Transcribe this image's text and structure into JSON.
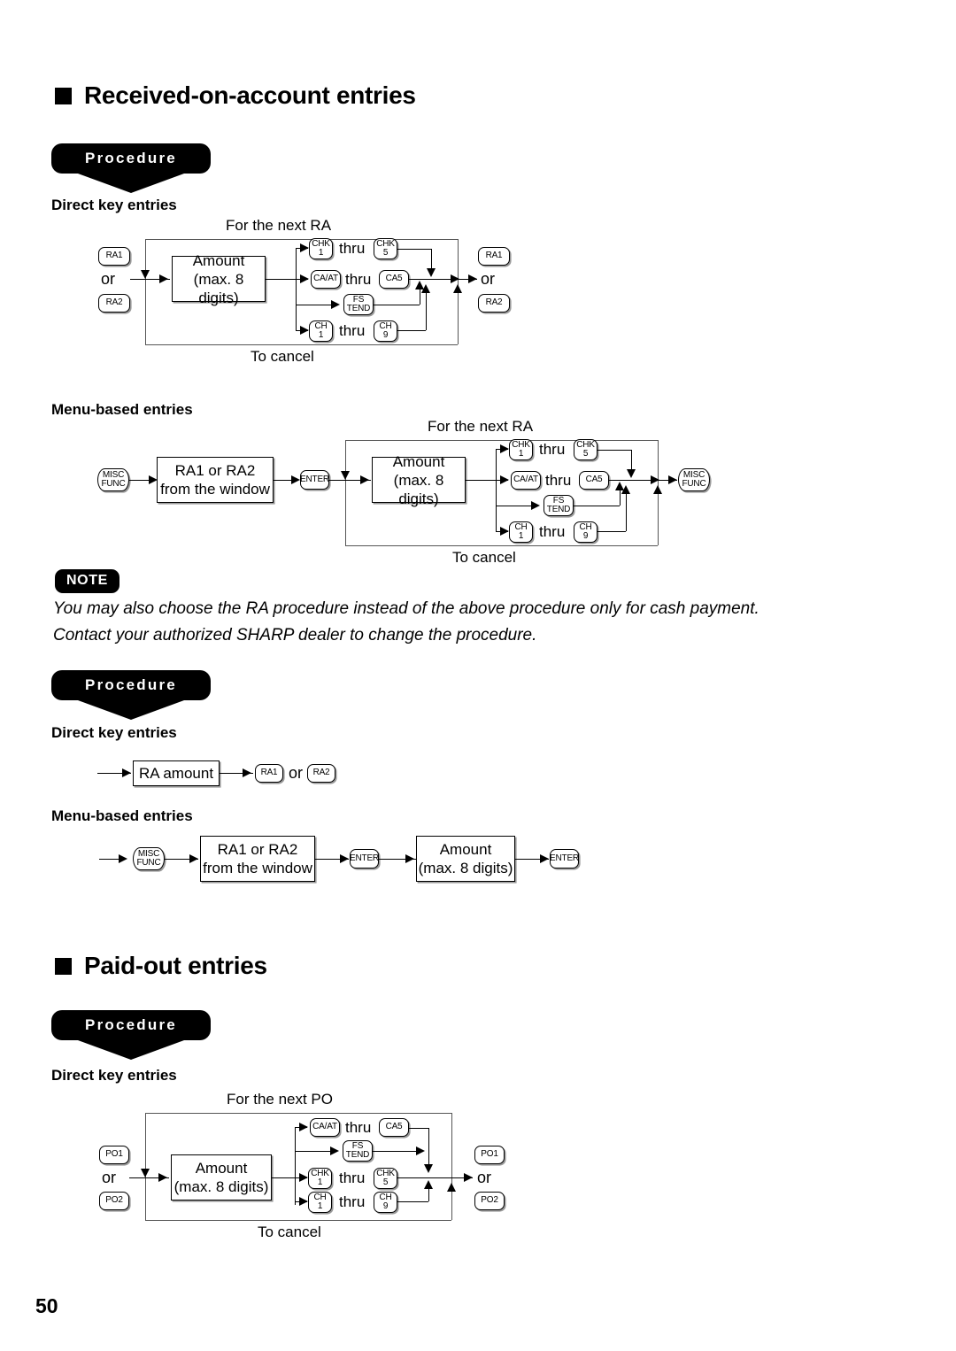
{
  "page": {
    "number": "50"
  },
  "sections": [
    {
      "title": "Received-on-account entries",
      "bullet": "black-square"
    },
    {
      "title": "Paid-out entries",
      "bullet": "black-square"
    }
  ],
  "labels": {
    "procedure": "Procedure",
    "direct_key_entries": "Direct key entries",
    "menu_based_entries": "Menu-based entries",
    "note_badge": "NOTE",
    "thru": "thru",
    "or": "or"
  },
  "note": {
    "line1": "You may also choose the RA procedure instead of the above procedure only for cash payment.",
    "line2": "Contact your authorized SHARP dealer to change the procedure."
  },
  "keys": {
    "ra1": "RA1",
    "ra2": "RA2",
    "po1": "PO1",
    "po2": "PO2",
    "chk1_top": "CHK",
    "chk1_bot": "1",
    "chk5_top": "CHK",
    "chk5_bot": "5",
    "caat": "CA/AT",
    "ca5": "CA5",
    "fs_top": "FS",
    "fs_bot": "TEND",
    "ch1_top": "CH",
    "ch1_bot": "1",
    "ch9_top": "CH",
    "ch9_bot": "9",
    "misc_top": "MISC",
    "misc_bot": "FUNC",
    "enter": "ENTER"
  },
  "boxes": {
    "amount_l1": "Amount",
    "amount_l2": "(max. 8 digits)",
    "ra_amount": "RA amount",
    "ra_window_l1": "RA1 or RA2",
    "ra_window_l2": "from the window"
  },
  "diagram1": {
    "name": "ra-direct-key-entries",
    "loop_top": "For the next RA",
    "loop_bottom": "To cancel"
  },
  "diagram2": {
    "name": "ra-menu-based-entries",
    "loop_top": "For the next RA",
    "loop_bottom": "To cancel"
  },
  "diagram5": {
    "name": "po-direct-key-entries",
    "loop_top": "For the next PO",
    "loop_bottom": "To cancel"
  }
}
